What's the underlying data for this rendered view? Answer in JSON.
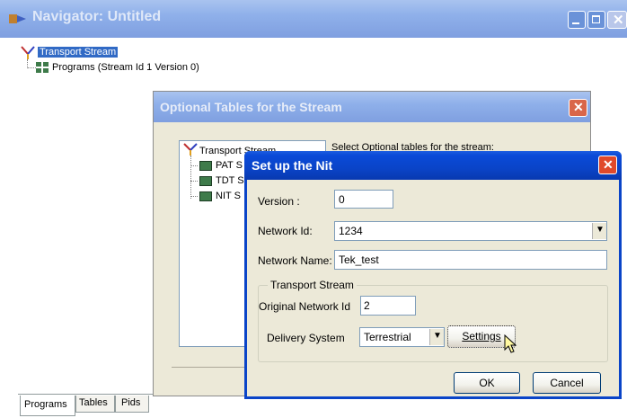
{
  "navigator": {
    "title": "Navigator: Untitled",
    "tree": {
      "root": "Transport Stream",
      "child": "Programs (Stream Id 1 Version 0)"
    },
    "tabs": [
      "Programs",
      "Tables",
      "Pids"
    ]
  },
  "optional_tables": {
    "title": "Optional Tables for the Stream",
    "tree_root": "Transport Stream",
    "tree_items": [
      "PAT S",
      "TDT S",
      "NIT S"
    ],
    "instruction": "Select Optional tables for the stream:"
  },
  "nit_dialog": {
    "title": "Set up the Nit",
    "version_label": "Version :",
    "version_value": "0",
    "network_id_label": "Network Id:",
    "network_id_value": "1234",
    "network_name_label": "Network Name:",
    "network_name_value": "Tek_test",
    "group_label": "Transport Stream",
    "orig_network_label": "Original Network Id",
    "orig_network_value": "2",
    "delivery_label": "Delivery System",
    "delivery_value": "Terrestrial",
    "settings_label": "Settings",
    "ok_label": "OK",
    "cancel_label": "Cancel"
  },
  "colors": {
    "xp_blue": "#0a44c8",
    "close_red": "#e0492b",
    "dialog_bg": "#ece9d8"
  }
}
